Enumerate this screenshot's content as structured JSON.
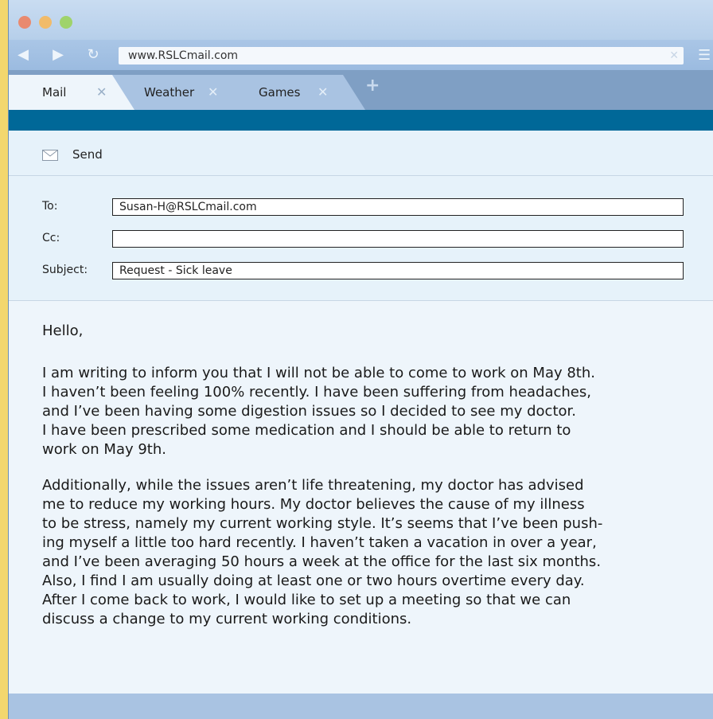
{
  "browser": {
    "url": "www.RSLCmail.com",
    "tabs": [
      {
        "label": "Mail"
      },
      {
        "label": "Weather"
      },
      {
        "label": "Games"
      }
    ]
  },
  "toolbar": {
    "send_label": "Send"
  },
  "email": {
    "to_label": "To:",
    "to_value": "Susan-H@RSLCmail.com",
    "cc_label": "Cc:",
    "cc_value": "",
    "subject_label": "Subject:",
    "subject_value": "Request - Sick leave",
    "greeting": "Hello,",
    "paragraph1": [
      "I am writing to inform you that I will not be able to come to work on May 8th.",
      "I haven’t been feeling 100% recently. I have been suffering from headaches,",
      "and I’ve been having some digestion issues so I decided to see my doctor.",
      "I have been prescribed some medication and I should be able to return to",
      "work on May 9th."
    ],
    "paragraph2": [
      "Additionally, while the issues aren’t life threatening, my doctor has advised",
      "me to reduce my working hours. My doctor believes the cause of my illness",
      "to be stress, namely my current working style. It’s seems that I’ve been push-",
      "ing myself a little too hard recently. I haven’t taken a vacation in over a year,",
      "and I’ve been averaging 50 hours a week at the office for the last six months.",
      "Also, I find I am usually doing at least one or two hours overtime every day.",
      "After I come back to work, I would like to set up a meeting so that we can",
      "discuss a change to my current working conditions."
    ]
  }
}
